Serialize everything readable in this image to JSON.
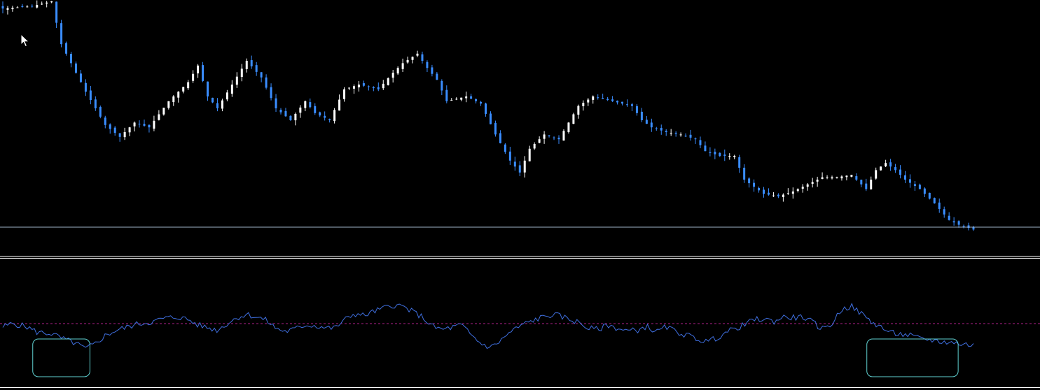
{
  "colors": {
    "background": "#000000",
    "bull_candle": "#ffffff",
    "bear_candle": "#3a8dff",
    "doji_candle": "#32cd32",
    "price_line": "#9fb4c8",
    "separator": "#ffffff",
    "indicator_line": "#3f6fe0",
    "level_line": "#b0208a",
    "highlight_box": "#5fd0d0",
    "cursor": "#ffffff"
  },
  "icons": {
    "cursor": "arrow-pointer-icon"
  },
  "chart_data": [
    {
      "type": "candlestick",
      "title": "",
      "xlabel": "",
      "ylabel": "",
      "grid": false,
      "ylim": [
        0,
        100
      ],
      "n_bars": 200,
      "current_price": 5.0,
      "price_path": [
        [
          0,
          97
        ],
        [
          6,
          98
        ],
        [
          10,
          100
        ],
        [
          12,
          82
        ],
        [
          17,
          62
        ],
        [
          21,
          48
        ],
        [
          24,
          43
        ],
        [
          27,
          49
        ],
        [
          30,
          47
        ],
        [
          34,
          58
        ],
        [
          38,
          66
        ],
        [
          40,
          73
        ],
        [
          42,
          60
        ],
        [
          44,
          55
        ],
        [
          47,
          65
        ],
        [
          50,
          75
        ],
        [
          53,
          68
        ],
        [
          56,
          55
        ],
        [
          59,
          50
        ],
        [
          62,
          58
        ],
        [
          64,
          53
        ],
        [
          67,
          50
        ],
        [
          70,
          63
        ],
        [
          73,
          65
        ],
        [
          77,
          63
        ],
        [
          80,
          70
        ],
        [
          82,
          74
        ],
        [
          85,
          78
        ],
        [
          87,
          72
        ],
        [
          89,
          67
        ],
        [
          91,
          58
        ],
        [
          95,
          60
        ],
        [
          98,
          57
        ],
        [
          101,
          44
        ],
        [
          104,
          33
        ],
        [
          106,
          28
        ],
        [
          108,
          38
        ],
        [
          111,
          44
        ],
        [
          114,
          42
        ],
        [
          116,
          49
        ],
        [
          118,
          56
        ],
        [
          121,
          60
        ],
        [
          125,
          58
        ],
        [
          129,
          56
        ],
        [
          131,
          50
        ],
        [
          133,
          47
        ],
        [
          136,
          45
        ],
        [
          139,
          44
        ],
        [
          142,
          42
        ],
        [
          144,
          37
        ],
        [
          147,
          35
        ],
        [
          150,
          35
        ],
        [
          152,
          25
        ],
        [
          156,
          19
        ],
        [
          159,
          18
        ],
        [
          162,
          20
        ],
        [
          165,
          23
        ],
        [
          168,
          26
        ],
        [
          171,
          26
        ],
        [
          174,
          27
        ],
        [
          177,
          21
        ],
        [
          179,
          29
        ],
        [
          181,
          32
        ],
        [
          183,
          29
        ],
        [
          185,
          25
        ],
        [
          188,
          21
        ],
        [
          191,
          15
        ],
        [
          194,
          8
        ],
        [
          196,
          6
        ],
        [
          199,
          4
        ]
      ]
    },
    {
      "type": "line",
      "title": "",
      "xlabel": "",
      "ylabel": "",
      "grid": false,
      "ylim": [
        0,
        100
      ],
      "level": 60,
      "indicator_path": [
        [
          0,
          55
        ],
        [
          2,
          60
        ],
        [
          5,
          55
        ],
        [
          7,
          47
        ],
        [
          10,
          45
        ],
        [
          12,
          38
        ],
        [
          15,
          30
        ],
        [
          17,
          22
        ],
        [
          19,
          30
        ],
        [
          21,
          42
        ],
        [
          23,
          49
        ],
        [
          26,
          56
        ],
        [
          28,
          60
        ],
        [
          31,
          63
        ],
        [
          33,
          68
        ],
        [
          36,
          70
        ],
        [
          38,
          66
        ],
        [
          40,
          58
        ],
        [
          42,
          54
        ],
        [
          44,
          50
        ],
        [
          46,
          60
        ],
        [
          48,
          69
        ],
        [
          50,
          74
        ],
        [
          52,
          70
        ],
        [
          54,
          65
        ],
        [
          56,
          53
        ],
        [
          58,
          48
        ],
        [
          60,
          52
        ],
        [
          62,
          58
        ],
        [
          64,
          57
        ],
        [
          66,
          54
        ],
        [
          68,
          53
        ],
        [
          70,
          65
        ],
        [
          72,
          75
        ],
        [
          74,
          72
        ],
        [
          76,
          78
        ],
        [
          78,
          83
        ],
        [
          80,
          88
        ],
        [
          82,
          86
        ],
        [
          84,
          78
        ],
        [
          86,
          70
        ],
        [
          88,
          56
        ],
        [
          90,
          51
        ],
        [
          92,
          54
        ],
        [
          94,
          58
        ],
        [
          96,
          43
        ],
        [
          98,
          30
        ],
        [
          100,
          24
        ],
        [
          102,
          34
        ],
        [
          104,
          47
        ],
        [
          106,
          56
        ],
        [
          108,
          63
        ],
        [
          110,
          68
        ],
        [
          112,
          73
        ],
        [
          114,
          72
        ],
        [
          116,
          67
        ],
        [
          118,
          62
        ],
        [
          120,
          53
        ],
        [
          122,
          51
        ],
        [
          124,
          58
        ],
        [
          126,
          53
        ],
        [
          128,
          49
        ],
        [
          130,
          50
        ],
        [
          132,
          56
        ],
        [
          134,
          47
        ],
        [
          136,
          55
        ],
        [
          138,
          48
        ],
        [
          140,
          43
        ],
        [
          142,
          38
        ],
        [
          144,
          33
        ],
        [
          146,
          37
        ],
        [
          148,
          46
        ],
        [
          150,
          52
        ],
        [
          152,
          58
        ],
        [
          154,
          66
        ],
        [
          156,
          67
        ],
        [
          158,
          63
        ],
        [
          160,
          70
        ],
        [
          162,
          69
        ],
        [
          164,
          70
        ],
        [
          166,
          62
        ],
        [
          168,
          52
        ],
        [
          170,
          60
        ],
        [
          172,
          82
        ],
        [
          174,
          86
        ],
        [
          176,
          75
        ],
        [
          178,
          63
        ],
        [
          180,
          55
        ],
        [
          182,
          46
        ],
        [
          184,
          44
        ],
        [
          186,
          42
        ],
        [
          188,
          37
        ],
        [
          190,
          36
        ],
        [
          192,
          33
        ],
        [
          194,
          32
        ],
        [
          196,
          30
        ],
        [
          198,
          28
        ],
        [
          199,
          28
        ]
      ],
      "highlight_ranges": [
        [
          7,
          17
        ],
        [
          178,
          195
        ]
      ]
    }
  ]
}
